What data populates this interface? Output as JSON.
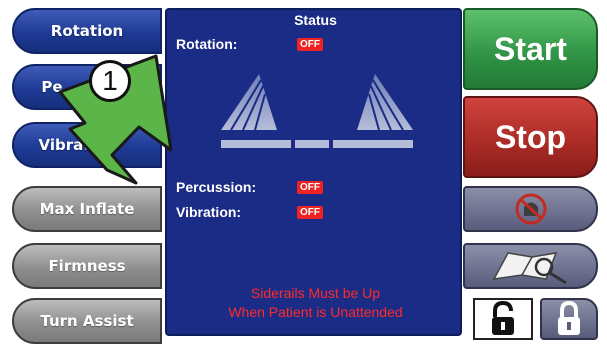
{
  "left_buttons": [
    {
      "label": "Rotation"
    },
    {
      "label": "Pe"
    },
    {
      "label": "Vibrati"
    },
    {
      "label": "Max Inflate"
    },
    {
      "label": "Firmness"
    },
    {
      "label": "Turn Assist"
    }
  ],
  "status": {
    "title": "Status",
    "rotation_label": "Rotation:",
    "rotation_value": "OFF",
    "percussion_label": "Percussion:",
    "percussion_value": "OFF",
    "vibration_label": "Vibration:",
    "vibration_value": "OFF",
    "warning_line1": "Siderails Must be Up",
    "warning_line2": "When Patient is Unattended"
  },
  "right_buttons": {
    "start_label": "Start",
    "stop_label": "Stop"
  },
  "icons": {
    "no_alarm": "no-bell-icon",
    "manual": "manual-search-icon",
    "unlock": "unlock-icon",
    "lock": "lock-icon"
  },
  "callout": {
    "step_number": "1",
    "color": "#5cb548"
  },
  "colors": {
    "panel": "#1a2c85",
    "status_off": "#ee2222",
    "warning_text": "#ff2a2a",
    "start": "#2f9244",
    "stop": "#a92a25"
  }
}
